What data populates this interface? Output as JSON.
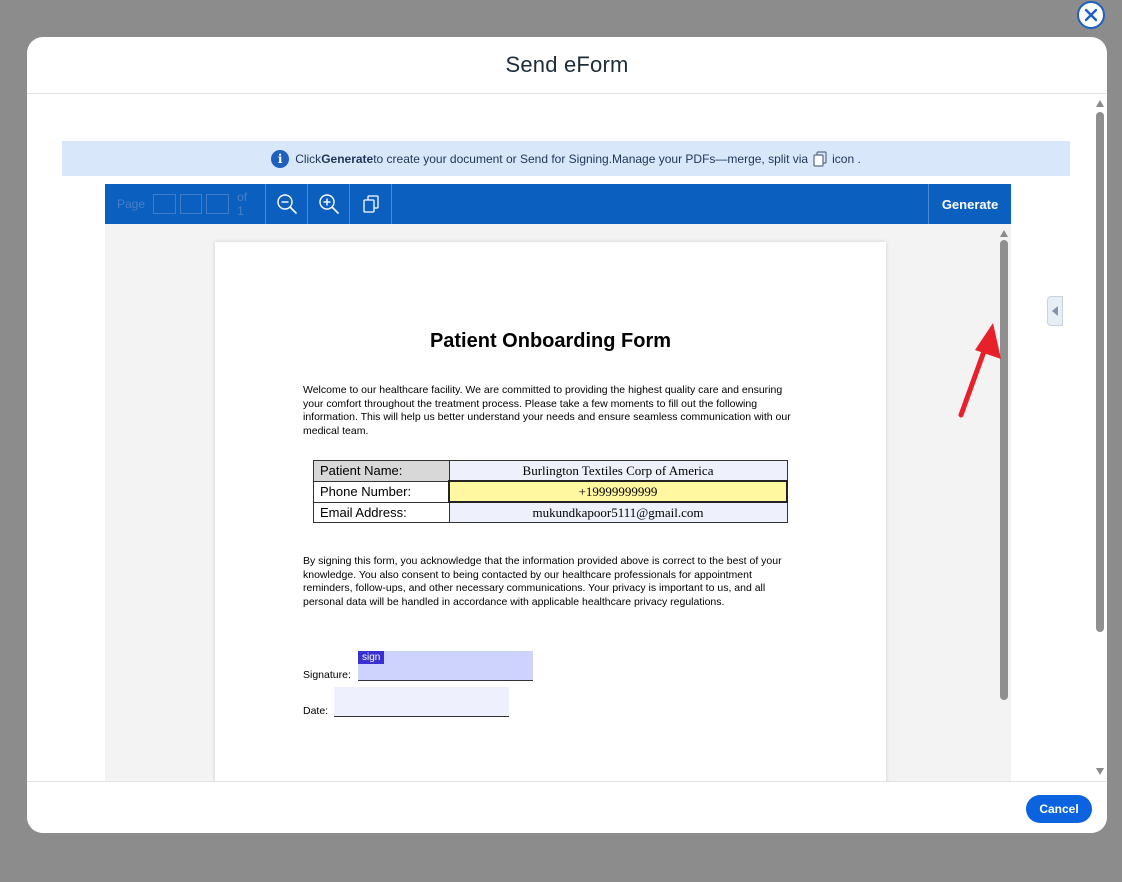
{
  "modal": {
    "title": "Send eForm"
  },
  "banner": {
    "prefix": "Click ",
    "bold": "Generate",
    "middle": " to create your document or Send for Signing.Manage your PDFs—merge, split via ",
    "suffix": " icon ."
  },
  "toolbar": {
    "page_label": "Page",
    "page_of": "of 1",
    "generate_label": "Generate"
  },
  "document": {
    "title": "Patient Onboarding Form",
    "intro": "Welcome to our healthcare facility. We are committed to providing the highest quality care and ensuring your comfort throughout the treatment process. Please take a few moments to fill out the following information. This will help us better understand your needs and ensure seamless communication with our medical team.",
    "fields": [
      {
        "label": "Patient Name:",
        "value": "Burlington Textiles Corp of America"
      },
      {
        "label": "Phone Number:",
        "value": "+19999999999"
      },
      {
        "label": "Email Address:",
        "value": "mukundkapoor5111@gmail.com"
      }
    ],
    "consent": "By signing this form, you acknowledge that the information provided above is correct to the best of your knowledge. You also consent to being contacted by our healthcare professionals for appointment reminders, follow-ups, and other necessary communications. Your privacy is important to us, and all personal data will be handled in accordance with applicable healthcare privacy regulations.",
    "signature_label": "Signature:",
    "sign_tag": "sign",
    "date_label": "Date:"
  },
  "footer": {
    "cancel_label": "Cancel"
  },
  "colors": {
    "toolbar": "#0b5fbe",
    "banner": "#d9e7fb",
    "active_field": "#fff8a0",
    "cancel": "#0b63e0",
    "arrow": "#e8202a"
  }
}
